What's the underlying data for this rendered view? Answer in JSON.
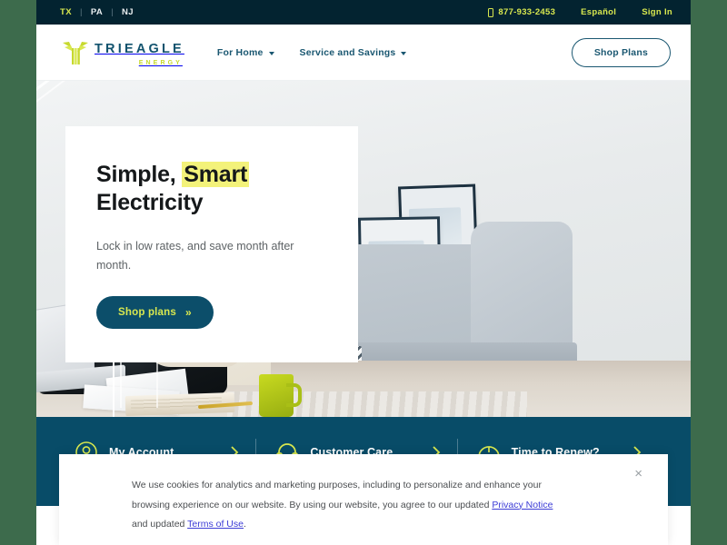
{
  "utility_bar": {
    "states": [
      {
        "label": "TX",
        "active": true
      },
      {
        "label": "PA",
        "active": false
      },
      {
        "label": "NJ",
        "active": false
      }
    ],
    "separator": "|",
    "phone": "877-933-2453",
    "espanol": "Español",
    "sign_in": "Sign In"
  },
  "brand": {
    "name": "TRIEAGLE",
    "tagline": "ENERGY",
    "mark_icon": "eagle-logo-icon"
  },
  "nav": {
    "links": [
      {
        "label": "For Home",
        "icon": "chevron-down-icon"
      },
      {
        "label": "Service and Savings",
        "icon": "chevron-down-icon"
      }
    ],
    "shop_plans": "Shop Plans"
  },
  "hero": {
    "title_pre": "Simple, ",
    "title_highlight": "Smart",
    "title_post": "Electricity",
    "subtitle": "Lock in low rates, and save month after month.",
    "cta_label": "Shop plans",
    "cta_chevron": "»"
  },
  "quick_links": [
    {
      "label": "My Account",
      "icon": "user-circle-icon",
      "arrow": "chevron-right-icon"
    },
    {
      "label": "Customer Care",
      "icon": "headset-icon",
      "arrow": "chevron-right-icon"
    },
    {
      "label": "Time to Renew?",
      "icon": "clock-icon",
      "arrow": "chevron-right-icon"
    }
  ],
  "cookie_banner": {
    "text_1": "We use cookies for analytics and marketing purposes, including to personalize and enhance your browsing experience on our website. By using our website, you agree to our updated ",
    "link_privacy": "Privacy Notice",
    "text_2": " and updated ",
    "link_terms": "Terms of Use",
    "text_3": ".",
    "close_label": "×"
  },
  "colors": {
    "utility_bar_bg": "#032330",
    "brand_navy": "#12536e",
    "brand_lime": "#d9e84f",
    "band_teal": "#084c68",
    "cta_bg": "#0c4e6a",
    "highlight_yellow": "#f3f27a",
    "link_blue": "#3c3cd6"
  }
}
